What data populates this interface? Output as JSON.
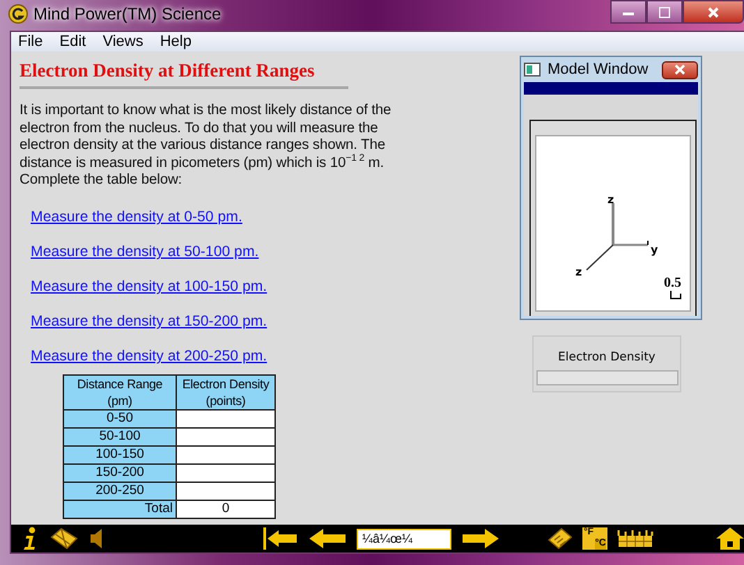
{
  "window": {
    "title": "Mind Power(TM) Science"
  },
  "menu": [
    {
      "label": "File"
    },
    {
      "label": "Edit"
    },
    {
      "label": "Views"
    },
    {
      "label": "Help"
    }
  ],
  "heading": "Electron Density at Different Ranges",
  "paragraph": "It is important to know what is the most likely distance of the electron from the nucleus. To do that you will measure the electron density at the various distance ranges shown. The distance is measured in picometers (pm) which is 10$^{−1 2}$ m. Complete the table below:",
  "links": [
    "Measure the density at 0-50 pm.",
    "Measure the density at 50-100 pm.",
    "Measure the density at 100-150 pm.",
    "Measure the density at 150-200 pm.",
    "Measure the density at 200-250 pm."
  ],
  "table": {
    "columns": [
      "Distance Range (pm)",
      "Electron Density (points)"
    ],
    "rows": [
      {
        "kind": "range",
        "range": "0-50"
      },
      {
        "kind": "range",
        "range": "50-100"
      },
      {
        "kind": "range",
        "range": "100-150"
      },
      {
        "kind": "range",
        "range": "150-200"
      },
      {
        "kind": "range",
        "range": "200-250"
      },
      {
        "kind": "total",
        "range": "Total",
        "density": "0"
      }
    ]
  },
  "model_window": {
    "title": "Model Window",
    "axis_labels": [
      "z",
      "y",
      "z"
    ],
    "scale": "0.5"
  },
  "density_panel": {
    "label": "Electron Density"
  },
  "toolbar": {
    "page_field": "¼â¼œ¼",
    "converter_labels": [
      "°F",
      "°C"
    ]
  }
}
